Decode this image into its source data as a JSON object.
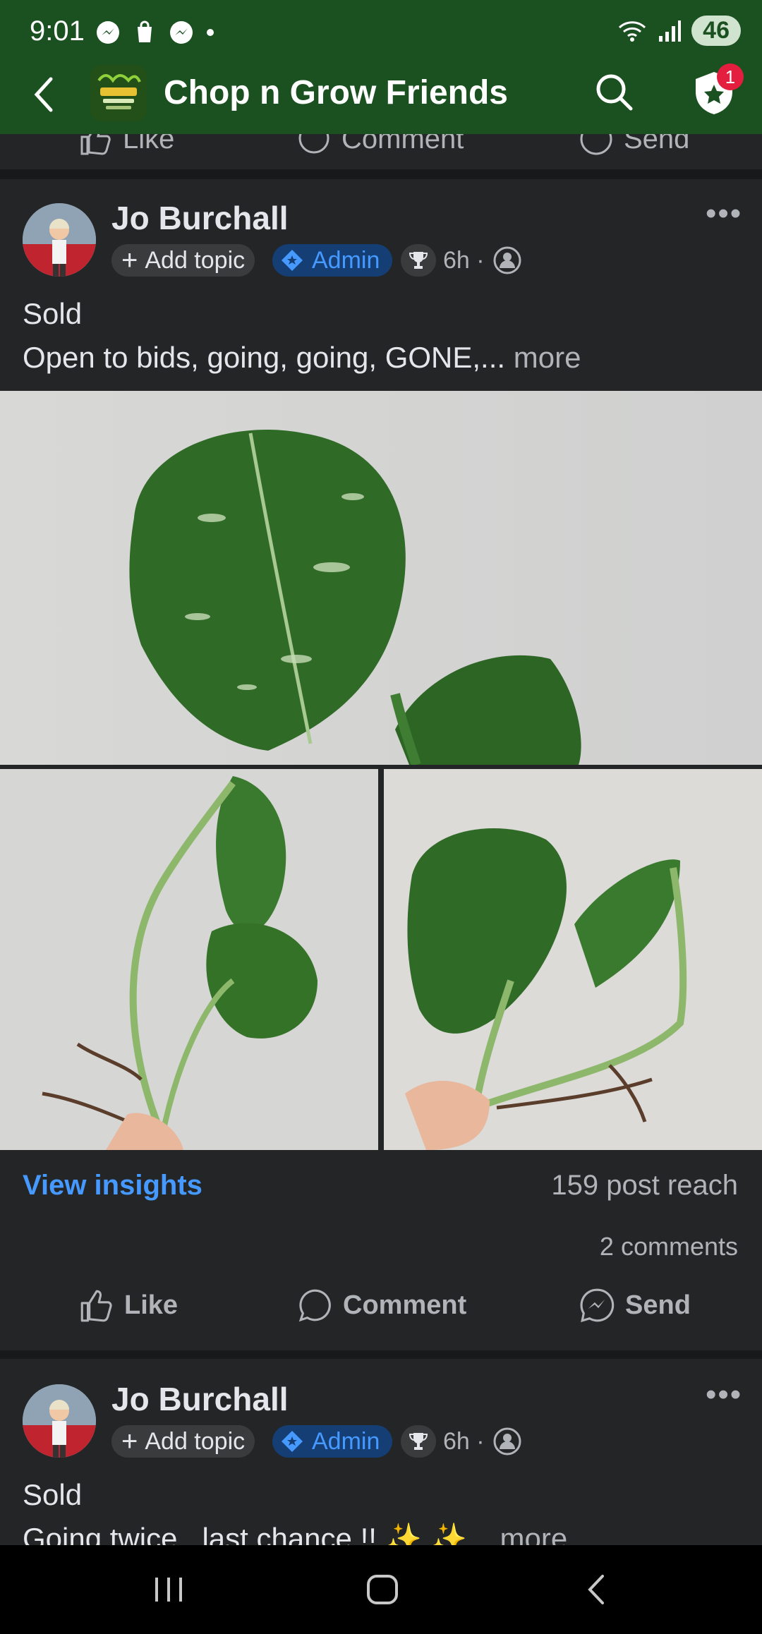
{
  "status_bar": {
    "time": "9:01",
    "battery": "46"
  },
  "header": {
    "title": "Chop n Grow Friends",
    "notification_count": "1"
  },
  "previous_post": {
    "actions": [
      "Like",
      "Comment",
      "Send"
    ]
  },
  "posts": [
    {
      "author": "Jo Burchall",
      "add_topic": "Add topic",
      "role": "Admin",
      "time": "6h ·",
      "line1": "Sold",
      "line2": "Open to bids, going, going, GONE,...",
      "more": "more",
      "insights": "View insights",
      "reach": "159 post reach",
      "comments": "2 comments",
      "actions": {
        "like": "Like",
        "comment": "Comment",
        "send": "Send"
      }
    },
    {
      "author": "Jo Burchall",
      "add_topic": "Add topic",
      "role": "Admin",
      "time": "6h ·",
      "line1": "Sold",
      "line2": "Going twice , last chance !! ✨ ✨...",
      "more": "more"
    }
  ],
  "colors": {
    "header_bg": "#1b5020",
    "card_bg": "#242526",
    "accent_blue": "#4599ff"
  }
}
